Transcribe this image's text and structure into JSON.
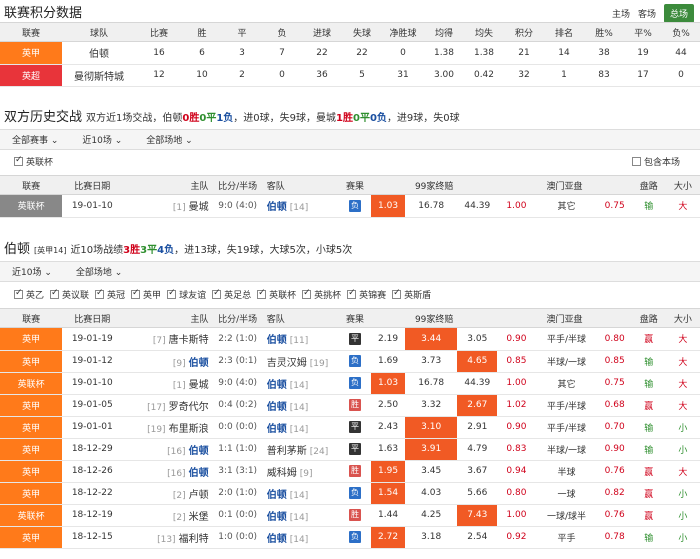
{
  "standings": {
    "title": "联赛积分数据",
    "tabs": [
      "主场",
      "客场",
      "总场"
    ],
    "active_tab": "总场",
    "headers": [
      "联赛",
      "球队",
      "比赛",
      "胜",
      "平",
      "负",
      "进球",
      "失球",
      "净胜球",
      "均得",
      "均失",
      "积分",
      "排名",
      "胜%",
      "平%",
      "负%"
    ],
    "rows": [
      {
        "league": "英甲",
        "team": "伯顿",
        "cells": [
          "16",
          "6",
          "3",
          "7",
          "22",
          "22",
          "0",
          "1.38",
          "1.38",
          "21",
          "14",
          "38",
          "19",
          "44"
        ]
      },
      {
        "league": "英超",
        "team": "曼彻斯特城",
        "cells": [
          "12",
          "10",
          "2",
          "0",
          "36",
          "5",
          "31",
          "3.00",
          "0.42",
          "32",
          "1",
          "83",
          "17",
          "0"
        ]
      }
    ]
  },
  "h2h": {
    "title": "双方历史交战",
    "summary": {
      "pre": "双方近1场交战，伯顿",
      "w": "0胜",
      "d": "0平",
      "l": "1负",
      "mid1": "，进0球，失9球，曼城",
      "w2": "1胜",
      "d2": "0平",
      "l2": "0负",
      "post": "，进9球，失0球"
    },
    "filters": [
      "全部赛事",
      "近10场",
      "全部场地"
    ],
    "checkbox_label": "英联杯",
    "same_home_label": "包含本场"
  },
  "table_headers": {
    "league": "联赛",
    "date": "比赛日期",
    "home": "主队",
    "score": "比分/半场",
    "away": "客队",
    "cond": "赛果",
    "odds": "99家终赔",
    "asian": "澳门亚盘",
    "pan": "盘路",
    "size": "大小"
  },
  "h2h_rows": [
    {
      "league": "英联杯",
      "lgc": "g",
      "date": "19-01-10",
      "home_rank": "[1]",
      "home": "曼城",
      "score": "9:0 (4:0)",
      "away": "伯顿",
      "away_rank": "[14]",
      "res": "负",
      "rescls": "l",
      "o1": "1.03",
      "o2": "16.78",
      "o3": "44.39",
      "hi": 1,
      "a1": "1.00",
      "a2": "其它",
      "a3": "0.75",
      "pan": "输",
      "size": "大"
    }
  ],
  "recent": {
    "title": "伯顿",
    "tag": "[英甲14]",
    "summary": {
      "pre": "近10场战绩",
      "w": "3胜",
      "d": "3平",
      "l": "4负",
      "post": "，进13球，失19球，大球5次，小球5次"
    },
    "filters": [
      "近10场",
      "全部场地"
    ],
    "checkboxes": [
      "英乙",
      "英议联",
      "英冠",
      "英甲",
      "球友谊",
      "英足总",
      "英联杯",
      "英挑杯",
      "英锦赛",
      "英斯盾"
    ]
  },
  "recent_rows": [
    {
      "league": "英甲",
      "lgc": "o",
      "date": "19-01-19",
      "home_rank": "[7]",
      "home": "唐卡斯特",
      "score": "2:2 (1:0)",
      "away": "伯顿",
      "away_rank": "[11]",
      "res": "平",
      "rescls": "d",
      "o1": "2.19",
      "o2": "3.44",
      "o3": "3.05",
      "hi": 2,
      "a1": "0.90",
      "a2": "平手/半球",
      "a3": "0.80",
      "pan": "赢",
      "size": "大"
    },
    {
      "league": "英甲",
      "lgc": "o",
      "date": "19-01-12",
      "home_rank": "[9]",
      "home": "伯顿",
      "score": "2:3 (0:1)",
      "away": "吉灵汉姆",
      "away_rank": "[19]",
      "res": "负",
      "rescls": "l",
      "o1": "1.69",
      "o2": "3.73",
      "o3": "4.65",
      "hi": 3,
      "a1": "0.85",
      "a2": "半球/一球",
      "a3": "0.85",
      "pan": "输",
      "size": "大"
    },
    {
      "league": "英联杯",
      "lgc": "o",
      "date": "19-01-10",
      "home_rank": "[1]",
      "home": "曼城",
      "score": "9:0 (4:0)",
      "away": "伯顿",
      "away_rank": "[14]",
      "res": "负",
      "rescls": "l",
      "o1": "1.03",
      "o2": "16.78",
      "o3": "44.39",
      "hi": 1,
      "a1": "1.00",
      "a2": "其它",
      "a3": "0.75",
      "pan": "输",
      "size": "大"
    },
    {
      "league": "英甲",
      "lgc": "o",
      "date": "19-01-05",
      "home_rank": "[17]",
      "home": "罗奇代尔",
      "score": "0:4 (0:2)",
      "away": "伯顿",
      "away_rank": "[14]",
      "res": "胜",
      "rescls": "w",
      "o1": "2.50",
      "o2": "3.32",
      "o3": "2.67",
      "hi": 3,
      "a1": "1.02",
      "a2": "平手/半球",
      "a3": "0.68",
      "pan": "赢",
      "size": "大"
    },
    {
      "league": "英甲",
      "lgc": "o",
      "date": "19-01-01",
      "home_rank": "[19]",
      "home": "布里斯浪",
      "score": "0:0 (0:0)",
      "away": "伯顿",
      "away_rank": "[14]",
      "res": "平",
      "rescls": "d",
      "o1": "2.43",
      "o2": "3.10",
      "o3": "2.91",
      "hi": 2,
      "a1": "0.90",
      "a2": "平手/半球",
      "a3": "0.70",
      "pan": "输",
      "size": "小"
    },
    {
      "league": "英甲",
      "lgc": "o",
      "date": "18-12-29",
      "home_rank": "[16]",
      "home": "伯顿",
      "score": "1:1 (1:0)",
      "away": "普利茅斯",
      "away_rank": "[24]",
      "res": "平",
      "rescls": "d",
      "o1": "1.63",
      "o2": "3.91",
      "o3": "4.79",
      "hi": 2,
      "a1": "0.83",
      "a2": "半球/一球",
      "a3": "0.90",
      "pan": "输",
      "size": "小"
    },
    {
      "league": "英甲",
      "lgc": "o",
      "date": "18-12-26",
      "home_rank": "[16]",
      "home": "伯顿",
      "score": "3:1 (3:1)",
      "away": "威科姆",
      "away_rank": "[9]",
      "res": "胜",
      "rescls": "w",
      "o1": "1.95",
      "o2": "3.45",
      "o3": "3.67",
      "hi": 1,
      "a1": "0.94",
      "a2": "半球",
      "a3": "0.76",
      "pan": "赢",
      "size": "大"
    },
    {
      "league": "英甲",
      "lgc": "o",
      "date": "18-12-22",
      "home_rank": "[2]",
      "home": "卢顿",
      "score": "2:0 (1:0)",
      "away": "伯顿",
      "away_rank": "[14]",
      "res": "负",
      "rescls": "l",
      "o1": "1.54",
      "o2": "4.03",
      "o3": "5.66",
      "hi": 1,
      "a1": "0.80",
      "a2": "一球",
      "a3": "0.82",
      "pan": "赢",
      "size": "小"
    },
    {
      "league": "英联杯",
      "lgc": "o",
      "date": "18-12-19",
      "home_rank": "[2]",
      "home": "米堡",
      "score": "0:1 (0:0)",
      "away": "伯顿",
      "away_rank": "[14]",
      "res": "胜",
      "rescls": "w",
      "o1": "1.44",
      "o2": "4.25",
      "o3": "7.43",
      "hi": 3,
      "a1": "1.00",
      "a2": "一球/球半",
      "a3": "0.76",
      "pan": "赢",
      "size": "小"
    },
    {
      "league": "英甲",
      "lgc": "o",
      "date": "18-12-15",
      "home_rank": "[13]",
      "home": "福利特",
      "score": "1:0 (0:0)",
      "away": "伯顿",
      "away_rank": "[14]",
      "res": "负",
      "rescls": "l",
      "o1": "2.72",
      "o2": "3.18",
      "o3": "2.54",
      "hi": 1,
      "a1": "0.92",
      "a2": "平手",
      "a3": "0.78",
      "pan": "输",
      "size": "小"
    }
  ]
}
